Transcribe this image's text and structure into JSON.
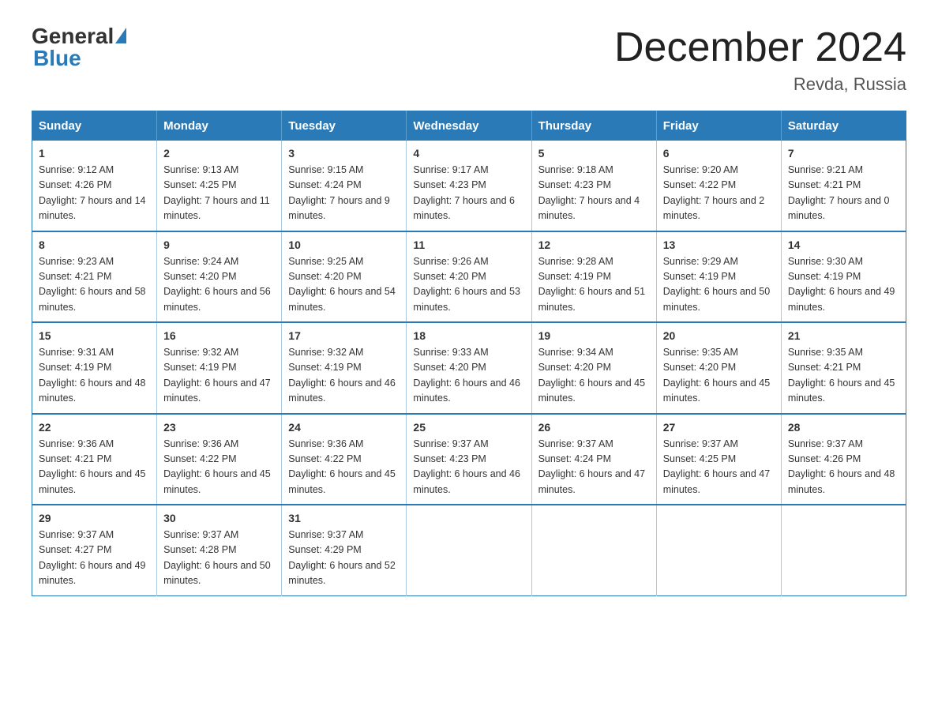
{
  "header": {
    "logo_general": "General",
    "logo_blue": "Blue",
    "title": "December 2024",
    "location": "Revda, Russia"
  },
  "days_of_week": [
    "Sunday",
    "Monday",
    "Tuesday",
    "Wednesday",
    "Thursday",
    "Friday",
    "Saturday"
  ],
  "weeks": [
    [
      {
        "day": "1",
        "sunrise": "9:12 AM",
        "sunset": "4:26 PM",
        "daylight": "7 hours and 14 minutes."
      },
      {
        "day": "2",
        "sunrise": "9:13 AM",
        "sunset": "4:25 PM",
        "daylight": "7 hours and 11 minutes."
      },
      {
        "day": "3",
        "sunrise": "9:15 AM",
        "sunset": "4:24 PM",
        "daylight": "7 hours and 9 minutes."
      },
      {
        "day": "4",
        "sunrise": "9:17 AM",
        "sunset": "4:23 PM",
        "daylight": "7 hours and 6 minutes."
      },
      {
        "day": "5",
        "sunrise": "9:18 AM",
        "sunset": "4:23 PM",
        "daylight": "7 hours and 4 minutes."
      },
      {
        "day": "6",
        "sunrise": "9:20 AM",
        "sunset": "4:22 PM",
        "daylight": "7 hours and 2 minutes."
      },
      {
        "day": "7",
        "sunrise": "9:21 AM",
        "sunset": "4:21 PM",
        "daylight": "7 hours and 0 minutes."
      }
    ],
    [
      {
        "day": "8",
        "sunrise": "9:23 AM",
        "sunset": "4:21 PM",
        "daylight": "6 hours and 58 minutes."
      },
      {
        "day": "9",
        "sunrise": "9:24 AM",
        "sunset": "4:20 PM",
        "daylight": "6 hours and 56 minutes."
      },
      {
        "day": "10",
        "sunrise": "9:25 AM",
        "sunset": "4:20 PM",
        "daylight": "6 hours and 54 minutes."
      },
      {
        "day": "11",
        "sunrise": "9:26 AM",
        "sunset": "4:20 PM",
        "daylight": "6 hours and 53 minutes."
      },
      {
        "day": "12",
        "sunrise": "9:28 AM",
        "sunset": "4:19 PM",
        "daylight": "6 hours and 51 minutes."
      },
      {
        "day": "13",
        "sunrise": "9:29 AM",
        "sunset": "4:19 PM",
        "daylight": "6 hours and 50 minutes."
      },
      {
        "day": "14",
        "sunrise": "9:30 AM",
        "sunset": "4:19 PM",
        "daylight": "6 hours and 49 minutes."
      }
    ],
    [
      {
        "day": "15",
        "sunrise": "9:31 AM",
        "sunset": "4:19 PM",
        "daylight": "6 hours and 48 minutes."
      },
      {
        "day": "16",
        "sunrise": "9:32 AM",
        "sunset": "4:19 PM",
        "daylight": "6 hours and 47 minutes."
      },
      {
        "day": "17",
        "sunrise": "9:32 AM",
        "sunset": "4:19 PM",
        "daylight": "6 hours and 46 minutes."
      },
      {
        "day": "18",
        "sunrise": "9:33 AM",
        "sunset": "4:20 PM",
        "daylight": "6 hours and 46 minutes."
      },
      {
        "day": "19",
        "sunrise": "9:34 AM",
        "sunset": "4:20 PM",
        "daylight": "6 hours and 45 minutes."
      },
      {
        "day": "20",
        "sunrise": "9:35 AM",
        "sunset": "4:20 PM",
        "daylight": "6 hours and 45 minutes."
      },
      {
        "day": "21",
        "sunrise": "9:35 AM",
        "sunset": "4:21 PM",
        "daylight": "6 hours and 45 minutes."
      }
    ],
    [
      {
        "day": "22",
        "sunrise": "9:36 AM",
        "sunset": "4:21 PM",
        "daylight": "6 hours and 45 minutes."
      },
      {
        "day": "23",
        "sunrise": "9:36 AM",
        "sunset": "4:22 PM",
        "daylight": "6 hours and 45 minutes."
      },
      {
        "day": "24",
        "sunrise": "9:36 AM",
        "sunset": "4:22 PM",
        "daylight": "6 hours and 45 minutes."
      },
      {
        "day": "25",
        "sunrise": "9:37 AM",
        "sunset": "4:23 PM",
        "daylight": "6 hours and 46 minutes."
      },
      {
        "day": "26",
        "sunrise": "9:37 AM",
        "sunset": "4:24 PM",
        "daylight": "6 hours and 47 minutes."
      },
      {
        "day": "27",
        "sunrise": "9:37 AM",
        "sunset": "4:25 PM",
        "daylight": "6 hours and 47 minutes."
      },
      {
        "day": "28",
        "sunrise": "9:37 AM",
        "sunset": "4:26 PM",
        "daylight": "6 hours and 48 minutes."
      }
    ],
    [
      {
        "day": "29",
        "sunrise": "9:37 AM",
        "sunset": "4:27 PM",
        "daylight": "6 hours and 49 minutes."
      },
      {
        "day": "30",
        "sunrise": "9:37 AM",
        "sunset": "4:28 PM",
        "daylight": "6 hours and 50 minutes."
      },
      {
        "day": "31",
        "sunrise": "9:37 AM",
        "sunset": "4:29 PM",
        "daylight": "6 hours and 52 minutes."
      },
      null,
      null,
      null,
      null
    ]
  ]
}
